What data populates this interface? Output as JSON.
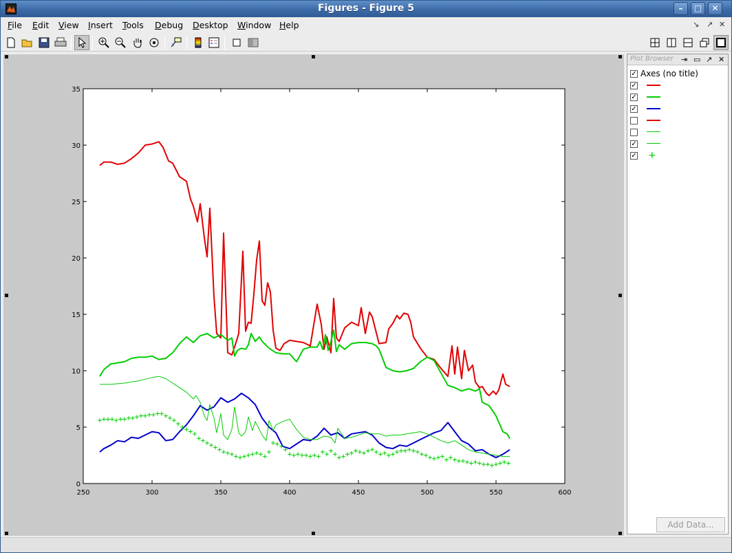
{
  "window": {
    "title": "Figures - Figure 5",
    "controls": [
      "minimize-icon",
      "maximize-icon",
      "close-icon"
    ]
  },
  "menu": {
    "items": [
      {
        "label": "File",
        "accel": "F",
        "rest": "ile"
      },
      {
        "label": "Edit",
        "accel": "E",
        "rest": "dit"
      },
      {
        "label": "View",
        "accel": "V",
        "rest": "iew"
      },
      {
        "label": "Insert",
        "accel": "I",
        "rest": "nsert"
      },
      {
        "label": "Tools",
        "accel": "T",
        "rest": "ools"
      },
      {
        "label": "Debug",
        "accel": "D",
        "rest": "ebug"
      },
      {
        "label": "Desktop",
        "accel": "D",
        "rest": "esktop"
      },
      {
        "label": "Window",
        "accel": "W",
        "rest": "indow"
      },
      {
        "label": "Help",
        "accel": "H",
        "rest": "elp"
      }
    ],
    "right_icons": [
      "dock-icon",
      "undock-icon",
      "close-icon"
    ]
  },
  "toolbar": {
    "icons": [
      "new-figure-icon",
      "open-file-icon",
      "save-icon",
      "print-icon",
      "edit-plot-icon",
      "zoom-in-icon",
      "zoom-out-icon",
      "pan-icon",
      "rotate-3d-icon",
      "data-cursor-icon",
      "colorbar-icon",
      "legend-icon",
      "hide-plot-tools-icon",
      "show-plot-tools-icon"
    ],
    "layout_icons": [
      "tile-icon",
      "left-right-icon",
      "top-bottom-icon",
      "float-icon",
      "maximize-icon"
    ]
  },
  "plot_browser": {
    "title": "Plot Browser",
    "axes_label": "Axes (no title)",
    "items": [
      {
        "checked": true,
        "color": "#e00000",
        "style": "thick-line"
      },
      {
        "checked": true,
        "color": "#00cc00",
        "style": "thick-line"
      },
      {
        "checked": true,
        "color": "#0000cc",
        "style": "thick-line"
      },
      {
        "checked": false,
        "color": "#e00000",
        "style": "thick-line"
      },
      {
        "checked": false,
        "color": "#00cc00",
        "style": "thin-line"
      },
      {
        "checked": true,
        "color": "#00cc00",
        "style": "thin-line"
      },
      {
        "checked": true,
        "color": "#00cc00",
        "style": "plus-marker"
      }
    ],
    "add_data_label": "Add Data..."
  },
  "chart_data": {
    "type": "line",
    "title": "",
    "xlabel": "",
    "ylabel": "",
    "xlim": [
      250,
      600
    ],
    "ylim": [
      0,
      35
    ],
    "xticks": [
      250,
      300,
      350,
      400,
      450,
      500,
      550,
      600
    ],
    "yticks": [
      0,
      5,
      10,
      15,
      20,
      25,
      30,
      35
    ],
    "grid": false,
    "series": [
      {
        "color": "#e00000",
        "width": 2,
        "marker": "none",
        "x": [
          262,
          265,
          270,
          275,
          280,
          285,
          290,
          295,
          300,
          305,
          308,
          312,
          315,
          320,
          325,
          328,
          330,
          333,
          335,
          338,
          340,
          342,
          345,
          347,
          350,
          352,
          355,
          358,
          360,
          363,
          366,
          368,
          370,
          372,
          374,
          376,
          378,
          380,
          382,
          384,
          386,
          388,
          390,
          393,
          396,
          400,
          405,
          410,
          415,
          420,
          423,
          425,
          427,
          430,
          432,
          434,
          436,
          440,
          445,
          450,
          452,
          455,
          458,
          460,
          465,
          470,
          472,
          475,
          478,
          480,
          483,
          486,
          488,
          490,
          495,
          500,
          505,
          510,
          515,
          518,
          520,
          522,
          525,
          527,
          530,
          533,
          535,
          538,
          540,
          543,
          545,
          548,
          550,
          552,
          555,
          557,
          560
        ],
        "y": [
          28.2,
          28.5,
          28.5,
          28.3,
          28.4,
          28.8,
          29.3,
          30.0,
          30.1,
          30.3,
          29.8,
          28.6,
          28.4,
          27.2,
          26.8,
          25.2,
          24.6,
          23.2,
          24.8,
          21.8,
          20.1,
          24.4,
          16.6,
          13.3,
          12.9,
          22.2,
          11.6,
          11.4,
          12.1,
          13.3,
          20.6,
          13.5,
          14.3,
          14.2,
          16.8,
          19.8,
          21.5,
          16.2,
          15.8,
          17.8,
          17.0,
          13.6,
          12.0,
          11.8,
          12.4,
          12.7,
          12.6,
          12.5,
          12.2,
          15.9,
          14.1,
          11.9,
          13.0,
          11.6,
          16.4,
          12.9,
          12.6,
          13.8,
          14.3,
          14.0,
          15.6,
          13.3,
          15.2,
          14.8,
          12.4,
          12.5,
          13.7,
          14.2,
          14.9,
          14.6,
          15.1,
          15.0,
          14.3,
          13.0,
          12.0,
          11.2,
          11.0,
          10.2,
          9.5,
          12.2,
          9.7,
          12.1,
          9.3,
          11.8,
          10.0,
          10.5,
          9.0,
          8.5,
          8.6,
          8.0,
          7.8,
          8.2,
          7.9,
          8.3,
          9.7,
          8.8,
          8.6
        ]
      },
      {
        "color": "#00cc00",
        "width": 2,
        "marker": "none",
        "x": [
          262,
          265,
          270,
          275,
          280,
          285,
          290,
          295,
          300,
          305,
          310,
          315,
          320,
          325,
          330,
          335,
          340,
          345,
          350,
          355,
          358,
          360,
          362,
          365,
          368,
          370,
          372,
          375,
          378,
          380,
          385,
          390,
          395,
          400,
          405,
          410,
          415,
          420,
          422,
          424,
          426,
          428,
          430,
          432,
          434,
          436,
          440,
          445,
          450,
          455,
          460,
          463,
          465,
          470,
          475,
          480,
          485,
          490,
          495,
          500,
          505,
          510,
          515,
          520,
          525,
          530,
          535,
          538,
          540,
          545,
          550,
          555,
          558,
          560
        ],
        "y": [
          9.5,
          10.1,
          10.6,
          10.7,
          10.8,
          11.1,
          11.2,
          11.2,
          11.3,
          11.0,
          11.1,
          11.6,
          12.4,
          13.0,
          12.5,
          13.1,
          13.3,
          12.9,
          13.2,
          12.7,
          12.9,
          11.3,
          11.8,
          12.0,
          11.9,
          12.3,
          13.3,
          12.6,
          13.0,
          12.6,
          12.0,
          11.6,
          11.5,
          11.5,
          10.8,
          11.9,
          12.1,
          12.1,
          12.6,
          11.9,
          13.2,
          11.8,
          12.6,
          13.6,
          11.7,
          12.3,
          11.9,
          12.4,
          12.5,
          12.5,
          12.4,
          12.2,
          11.9,
          10.3,
          10.0,
          9.9,
          10.0,
          10.2,
          10.8,
          11.2,
          10.9,
          9.8,
          8.7,
          8.5,
          8.2,
          8.4,
          8.2,
          8.4,
          7.2,
          6.9,
          6.0,
          4.6,
          4.4,
          4.0
        ]
      },
      {
        "color": "#0000cc",
        "width": 2,
        "marker": "none",
        "x": [
          262,
          265,
          270,
          275,
          280,
          285,
          290,
          295,
          300,
          305,
          310,
          315,
          320,
          325,
          330,
          335,
          340,
          345,
          350,
          355,
          360,
          365,
          370,
          375,
          380,
          385,
          390,
          395,
          400,
          405,
          410,
          415,
          420,
          425,
          430,
          435,
          440,
          445,
          450,
          455,
          460,
          465,
          470,
          475,
          480,
          485,
          490,
          495,
          500,
          505,
          510,
          515,
          520,
          525,
          530,
          535,
          540,
          545,
          550,
          555,
          560
        ],
        "y": [
          2.8,
          3.1,
          3.4,
          3.8,
          3.7,
          4.1,
          4.0,
          4.3,
          4.6,
          4.5,
          3.8,
          3.9,
          4.6,
          5.2,
          6.0,
          6.9,
          6.5,
          6.8,
          7.6,
          7.2,
          7.5,
          8.0,
          7.6,
          7.0,
          5.8,
          5.0,
          4.5,
          3.3,
          3.1,
          3.5,
          3.9,
          3.8,
          4.2,
          4.9,
          4.3,
          4.5,
          4.0,
          4.4,
          4.5,
          4.6,
          4.3,
          3.6,
          3.2,
          3.1,
          3.4,
          3.3,
          3.6,
          3.9,
          4.2,
          4.5,
          4.7,
          5.4,
          4.6,
          3.8,
          3.5,
          2.9,
          3.0,
          2.6,
          2.3,
          2.6,
          3.0
        ]
      },
      {
        "color": "#00cc00",
        "width": 1,
        "marker": "none",
        "x": [
          262,
          270,
          280,
          290,
          300,
          305,
          310,
          315,
          320,
          325,
          330,
          332,
          335,
          338,
          340,
          342,
          345,
          347,
          350,
          352,
          355,
          358,
          360,
          363,
          365,
          368,
          370,
          373,
          375,
          378,
          380,
          383,
          385,
          388,
          390,
          395,
          400,
          405,
          410,
          415,
          420,
          425,
          430,
          433,
          435,
          440,
          445,
          450,
          455,
          460,
          465,
          470,
          475,
          480,
          485,
          490,
          495,
          500,
          505,
          510,
          515,
          520,
          525,
          530,
          535,
          540,
          545,
          550,
          555,
          560
        ],
        "y": [
          8.8,
          8.8,
          8.9,
          9.1,
          9.4,
          9.5,
          9.3,
          8.9,
          8.5,
          8.1,
          7.5,
          7.8,
          7.2,
          6.0,
          5.6,
          7.0,
          5.8,
          4.5,
          6.2,
          4.3,
          3.9,
          4.8,
          6.8,
          4.5,
          4.2,
          4.6,
          5.9,
          4.7,
          5.5,
          4.8,
          4.3,
          3.8,
          5.6,
          4.7,
          5.2,
          5.5,
          5.7,
          4.8,
          4.1,
          3.9,
          3.9,
          4.2,
          4.1,
          3.6,
          4.9,
          4.0,
          4.1,
          4.3,
          4.5,
          4.4,
          4.4,
          4.2,
          4.3,
          4.3,
          4.4,
          4.5,
          4.6,
          4.4,
          4.1,
          3.8,
          3.6,
          3.8,
          3.4,
          3.0,
          2.8,
          2.7,
          2.6,
          2.5,
          2.4,
          2.4
        ]
      },
      {
        "color": "#00cc00",
        "width": 1,
        "marker": "plus",
        "x": [
          262,
          265,
          268,
          271,
          274,
          277,
          280,
          283,
          286,
          289,
          292,
          295,
          298,
          301,
          304,
          307,
          310,
          313,
          316,
          319,
          322,
          325,
          328,
          331,
          334,
          337,
          340,
          343,
          346,
          349,
          352,
          355,
          358,
          361,
          364,
          367,
          370,
          373,
          376,
          379,
          382,
          385,
          388,
          391,
          394,
          397,
          400,
          403,
          406,
          409,
          412,
          415,
          418,
          421,
          424,
          427,
          430,
          433,
          436,
          439,
          442,
          445,
          448,
          451,
          454,
          457,
          460,
          463,
          466,
          469,
          472,
          475,
          478,
          481,
          484,
          487,
          490,
          493,
          496,
          499,
          502,
          505,
          508,
          511,
          514,
          517,
          520,
          523,
          526,
          529,
          532,
          535,
          538,
          541,
          544,
          547,
          550,
          553,
          556,
          559
        ],
        "y": [
          5.6,
          5.7,
          5.7,
          5.7,
          5.6,
          5.7,
          5.7,
          5.8,
          5.8,
          5.9,
          6.0,
          6.0,
          6.1,
          6.1,
          6.2,
          6.2,
          6.0,
          5.8,
          5.6,
          5.3,
          5.0,
          4.8,
          4.6,
          4.4,
          4.0,
          3.8,
          3.6,
          3.4,
          3.2,
          3.0,
          2.8,
          2.7,
          2.6,
          2.4,
          2.3,
          2.4,
          2.5,
          2.6,
          2.7,
          2.6,
          2.4,
          2.8,
          3.6,
          3.5,
          3.3,
          3.0,
          2.6,
          2.5,
          2.6,
          2.5,
          2.5,
          2.4,
          2.5,
          2.4,
          2.8,
          2.6,
          2.9,
          2.6,
          2.3,
          2.4,
          2.6,
          2.7,
          2.9,
          2.8,
          2.7,
          2.9,
          3.0,
          2.8,
          2.6,
          2.7,
          2.5,
          2.6,
          2.8,
          2.9,
          2.9,
          3.0,
          2.9,
          2.8,
          2.6,
          2.5,
          2.3,
          2.2,
          2.3,
          2.4,
          2.1,
          2.3,
          2.1,
          2.0,
          2.0,
          1.9,
          1.8,
          1.9,
          1.8,
          1.7,
          1.7,
          1.6,
          1.7,
          1.8,
          1.9,
          1.8
        ]
      }
    ]
  }
}
